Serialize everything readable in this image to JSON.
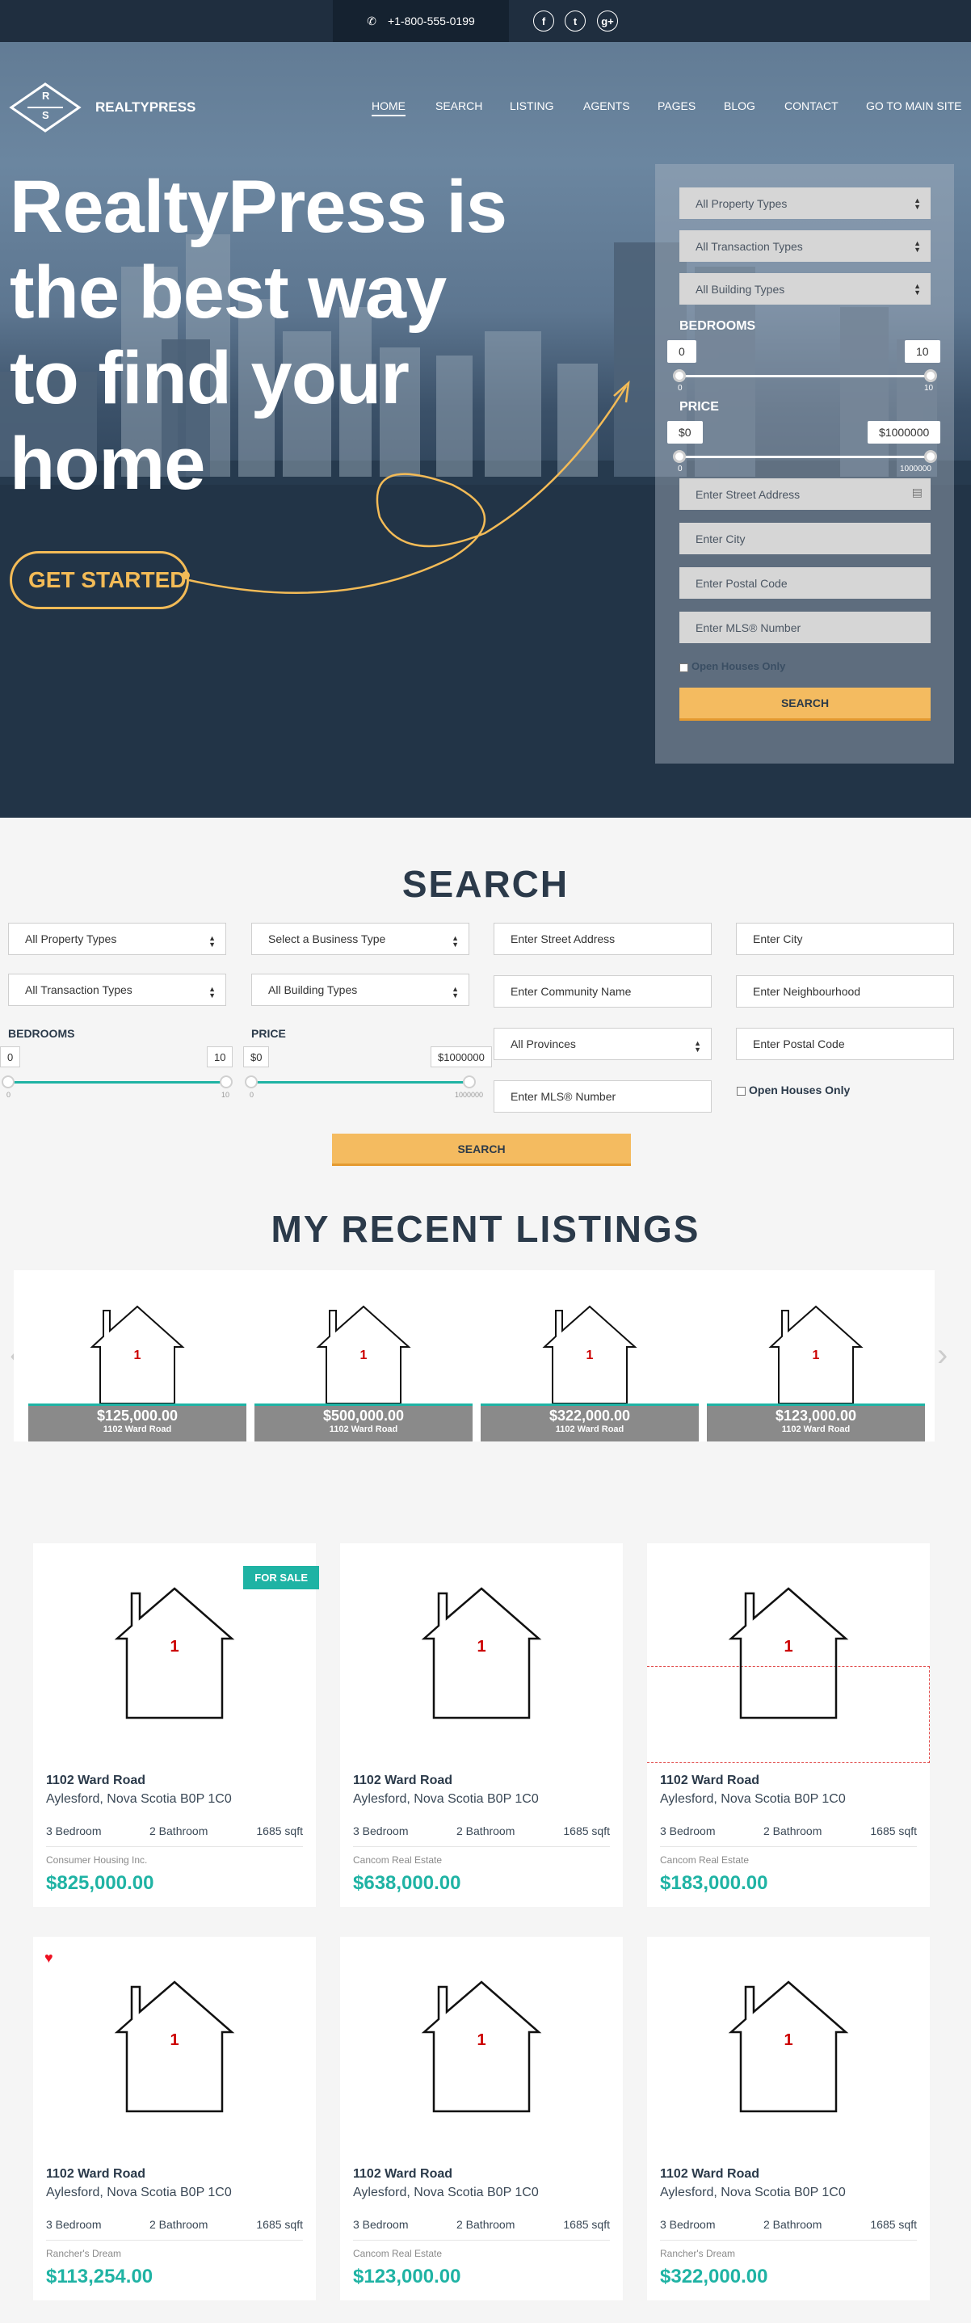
{
  "topbar": {
    "phone": "+1-800-555-0199",
    "social": [
      "f",
      "t",
      "g+"
    ]
  },
  "brand": {
    "logo_letters": [
      "R",
      "S"
    ],
    "name": "REALTYPRESS"
  },
  "nav": {
    "items": [
      "HOME",
      "SEARCH",
      "LISTING",
      "AGENTS",
      "PAGES",
      "BLOG",
      "CONTACT",
      "GO TO MAIN SITE"
    ]
  },
  "hero": {
    "headline_lines": [
      "RealtyPress is",
      "the best way",
      "to find your",
      "home"
    ],
    "cta": "GET STARTED"
  },
  "side_search": {
    "selects": [
      "All Property Types",
      "All Transaction Types",
      "All Building Types"
    ],
    "bedrooms_label": "BEDROOMS",
    "bed_min": "0",
    "bed_max": "10",
    "bed_tick_min": "0",
    "bed_tick_max": "10",
    "price_label": "PRICE",
    "price_min": "$0",
    "price_max": "$1000000",
    "price_tick_min": "0",
    "price_tick_max": "1000000",
    "inputs": [
      "Enter Street Address",
      "Enter City",
      "Enter Postal Code",
      "Enter MLS® Number"
    ],
    "open_houses": "Open Houses Only",
    "button": "SEARCH"
  },
  "search": {
    "title": "SEARCH",
    "col1": [
      "All Property Types",
      "All Transaction Types"
    ],
    "col2": [
      "Select a Business Type",
      "All Building Types"
    ],
    "col3": [
      "Enter Street Address",
      "Enter Community Name",
      "All Provinces",
      "Enter MLS® Number"
    ],
    "col4": [
      "Enter City",
      "Enter Neighbourhood",
      "Enter Postal Code"
    ],
    "bedrooms_label": "BEDROOMS",
    "bed_min": "0",
    "bed_max": "10",
    "bed_tick_min": "0",
    "bed_tick_max": "10",
    "price_label": "PRICE",
    "price_min": "$0",
    "price_max": "$1000000",
    "price_tick_min": "0",
    "price_tick_max": "1000000",
    "open_houses": "Open Houses Only",
    "button": "SEARCH"
  },
  "recent": {
    "title": "MY RECENT LISTINGS",
    "items": [
      {
        "price": "$125,000.00",
        "address": "1102 Ward Road",
        "img": "1"
      },
      {
        "price": "$500,000.00",
        "address": "1102 Ward Road",
        "img": "1"
      },
      {
        "price": "$322,000.00",
        "address": "1102 Ward Road",
        "img": "1"
      },
      {
        "price": "$123,000.00",
        "address": "1102 Ward Road",
        "img": "1"
      }
    ]
  },
  "listings": [
    {
      "img": "1",
      "address": "1102 Ward Road",
      "city": "Aylesford, Nova Scotia B0P 1C0",
      "beds": "3 Bedroom",
      "baths": "2 Bathroom",
      "sqft": "1685 sqft",
      "agent": "Consumer Housing Inc.",
      "price": "$825,000.00",
      "badge": "FOR SALE"
    },
    {
      "img": "1",
      "address": "1102 Ward Road",
      "city": "Aylesford, Nova Scotia B0P 1C0",
      "beds": "3 Bedroom",
      "baths": "2 Bathroom",
      "sqft": "1685 sqft",
      "agent": "Cancom Real Estate",
      "price": "$638,000.00"
    },
    {
      "img": "1",
      "address": "1102 Ward Road",
      "city": "Aylesford, Nova Scotia B0P 1C0",
      "beds": "3 Bedroom",
      "baths": "2 Bathroom",
      "sqft": "1685 sqft",
      "agent": "Cancom Real Estate",
      "price": "$183,000.00"
    },
    {
      "img": "1",
      "address": "1102 Ward Road",
      "city": "Aylesford, Nova Scotia B0P 1C0",
      "beds": "3 Bedroom",
      "baths": "2 Bathroom",
      "sqft": "1685 sqft",
      "agent": "Rancher's Dream",
      "price": "$113,254.00"
    },
    {
      "img": "1",
      "address": "1102 Ward Road",
      "city": "Aylesford, Nova Scotia B0P 1C0",
      "beds": "3 Bedroom",
      "baths": "2 Bathroom",
      "sqft": "1685 sqft",
      "agent": "Cancom Real Estate",
      "price": "$123,000.00"
    },
    {
      "img": "1",
      "address": "1102 Ward Road",
      "city": "Aylesford, Nova Scotia B0P 1C0",
      "beds": "3 Bedroom",
      "baths": "2 Bathroom",
      "sqft": "1685 sqft",
      "agent": "Rancher's Dream",
      "price": "$322,000.00"
    }
  ],
  "colors": {
    "accent": "#1fb3a4",
    "cta": "#f4bb60",
    "heading": "#2b3a4a",
    "topbar": "#1f2e3f"
  },
  "icons": [
    "phone-icon",
    "facebook-icon",
    "twitter-icon",
    "google-plus-icon",
    "logo-diamond-icon",
    "select-arrows-icon",
    "calendar-icon",
    "house-placeholder-icon",
    "heart-icon",
    "chevron-left-icon",
    "chevron-right-icon"
  ]
}
